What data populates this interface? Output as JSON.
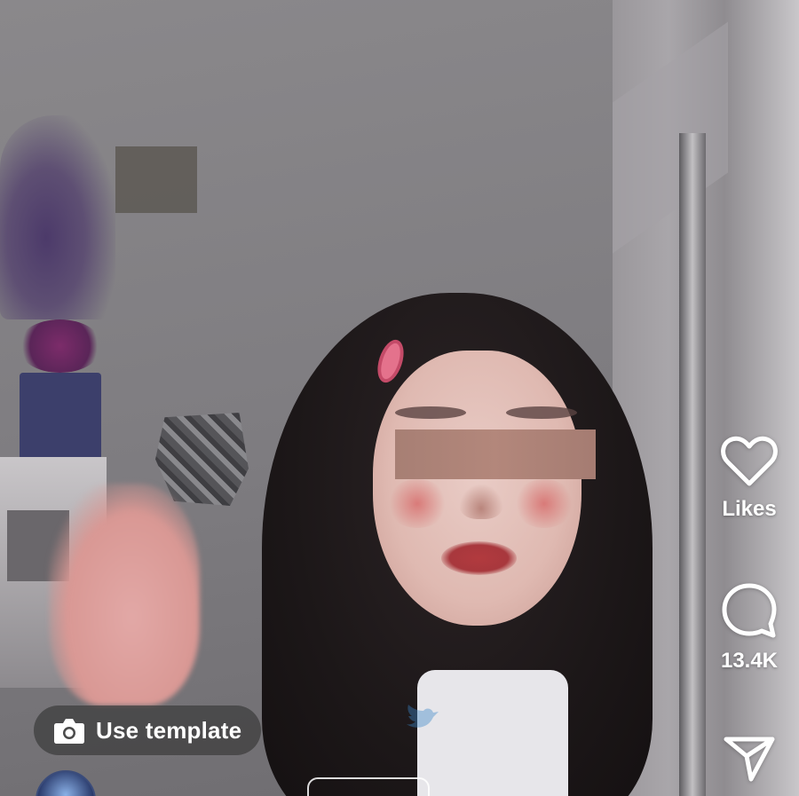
{
  "reel": {
    "actions": {
      "likes_label": "Likes",
      "comments_count": "13.4K"
    },
    "use_template_label": "Use template",
    "author": {
      "username": "",
      "follow_label": ""
    }
  },
  "icons": {
    "like": "heart-outline-icon",
    "comment": "speech-bubble-icon",
    "share": "paper-plane-icon",
    "template": "camera-icon"
  },
  "colors": {
    "overlay_text": "#ffffff",
    "pill_background": "#3c3c3c",
    "censor_bar": "#ad8478"
  }
}
